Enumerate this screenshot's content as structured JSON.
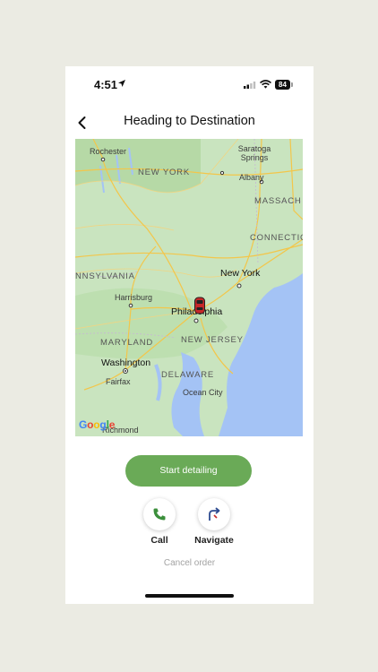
{
  "status_bar": {
    "time": "4:51",
    "battery": "84"
  },
  "header": {
    "title": "Heading to Destination"
  },
  "map": {
    "attribution": "Google",
    "labels": {
      "rochester": "Rochester",
      "saratoga": "Saratoga Springs",
      "new_york_state": "NEW YORK",
      "albany": "Albany",
      "massachusetts": "MASSACH",
      "connecticut": "CONNECTIC",
      "pennsylvania": "NNSYLVANIA",
      "new_york_city": "New York",
      "harrisburg": "Harrisburg",
      "philadelphia": "Philadelphia",
      "maryland": "MARYLAND",
      "new_jersey": "NEW JERSEY",
      "washington": "Washington",
      "delaware": "DELAWARE",
      "fairfax": "Fairfax",
      "ocean_city": "Ocean City",
      "richmond": "Richmond"
    }
  },
  "actions": {
    "start_label": "Start detailing",
    "call_label": "Call",
    "navigate_label": "Navigate",
    "cancel_label": "Cancel order"
  },
  "colors": {
    "accent": "#6aaa57",
    "water": "#a4c3f5",
    "land": "#c9e4bf"
  }
}
